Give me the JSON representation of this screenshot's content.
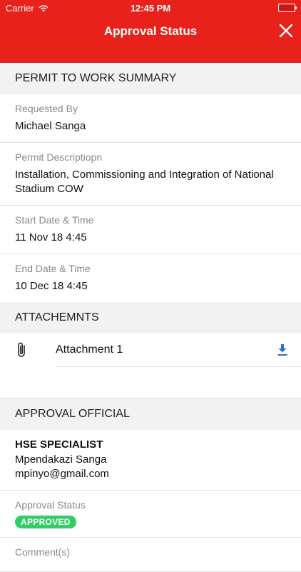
{
  "status_bar": {
    "carrier": "Carrier",
    "time": "12:45 PM"
  },
  "nav": {
    "title": "Approval Status"
  },
  "summary": {
    "header": "PERMIT TO WORK SUMMARY",
    "fields": [
      {
        "label": "Requested By",
        "value": "Michael Sanga"
      },
      {
        "label": "Permit Descriptiopn",
        "value": "Installation, Commissioning and Integration of National Stadium COW"
      },
      {
        "label": "Start Date & Time",
        "value": "11 Nov 18 4:45"
      },
      {
        "label": "End Date & Time",
        "value": "10 Dec 18 4:45"
      }
    ]
  },
  "attachments": {
    "header": "ATTACHEMNTS",
    "items": [
      {
        "label": "Attachment 1"
      }
    ]
  },
  "approval": {
    "header": "APPROVAL OFFICIAL",
    "role": "HSE SPECIALIST",
    "name": "Mpendakazi Sanga",
    "email": "mpinyo@gmail.com",
    "status_label": "Approval Status",
    "status_value": "APPROVED",
    "comments_label": "Comment(s)"
  },
  "colors": {
    "brand": "#e8211b",
    "approved": "#2fcf64",
    "download": "#2f6fd6"
  }
}
